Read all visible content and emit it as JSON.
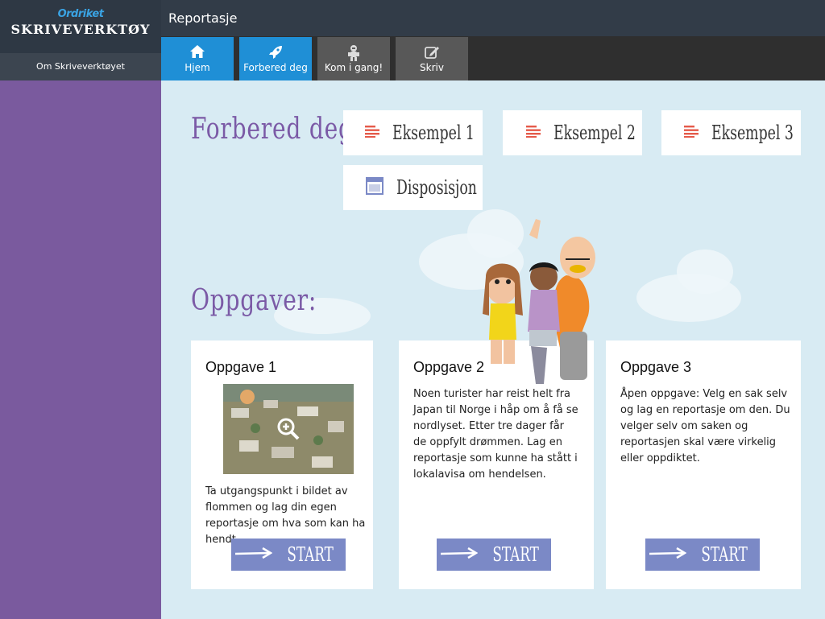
{
  "app": {
    "brand": "Ordriket",
    "product": "SKRIVEVERKTØY",
    "about_link": "Om Skriveverktøyet"
  },
  "header": {
    "title": "Reportasje"
  },
  "nav": {
    "tabs": [
      {
        "label": "Hjem",
        "icon": "home-icon",
        "active": true
      },
      {
        "label": "Forbered deg",
        "icon": "rocket-icon",
        "active": true
      },
      {
        "label": "Kom i gang!",
        "icon": "astronaut-icon",
        "active": false
      },
      {
        "label": "Skriv",
        "icon": "edit-icon",
        "active": false
      }
    ]
  },
  "prepare": {
    "title": "Forbered deg:",
    "buttons": [
      {
        "label": "Eksempel 1",
        "icon": "text-lines-icon"
      },
      {
        "label": "Eksempel 2",
        "icon": "text-lines-icon"
      },
      {
        "label": "Eksempel 3",
        "icon": "text-lines-icon"
      },
      {
        "label": "Disposisjon",
        "icon": "window-icon"
      }
    ]
  },
  "tasks": {
    "title": "Oppgaver:",
    "items": [
      {
        "title": "Oppgave 1",
        "description": "Ta utgangspunkt i bildet av flommen og lag din egen reportasje om hva som kan ha hendt.",
        "has_image": true,
        "start_label": "START"
      },
      {
        "title": "Oppgave 2",
        "description": "Noen turister har reist helt fra Japan til Norge i håp om å få se nordlyset. Etter tre dager får de oppfylt drømmen. Lag en reportasje som kunne ha stått i lokalavisa om hendelsen.",
        "has_image": false,
        "start_label": "START"
      },
      {
        "title": "Oppgave 3",
        "description": "Åpen oppgave: Velg en sak selv og lag en reportasje om den. Du velger selv om saken og reportasjen skal være virkelig eller oppdiktet.",
        "has_image": false,
        "start_label": "START"
      }
    ]
  },
  "colors": {
    "sidebar": "#7a5a9e",
    "header": "#323c48",
    "active_tab": "#1f8fd6",
    "inactive_tab": "#585858",
    "title_purple": "#7b5aa6",
    "start_button": "#7b89c6",
    "icon_red": "#e55a4a",
    "background": "#d8ebf3"
  }
}
